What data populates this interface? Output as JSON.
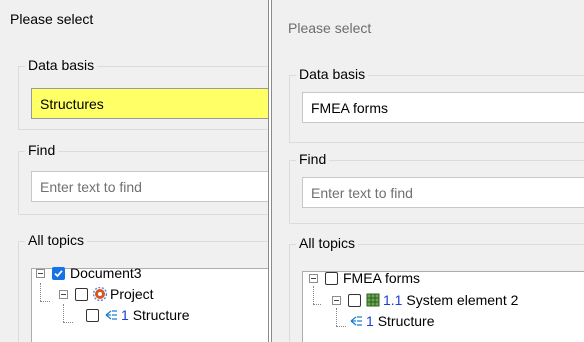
{
  "left": {
    "title": "Please select",
    "data_basis": {
      "label": "Data basis",
      "value": "Structures",
      "highlight_color": "#ffff66"
    },
    "find": {
      "label": "Find",
      "placeholder": "Enter text to find"
    },
    "topics": {
      "label": "All topics",
      "nodes": [
        {
          "label": "Document3",
          "checked": true
        },
        {
          "label": "Project",
          "checked": false,
          "icon": "gear-icon"
        },
        {
          "number": "1",
          "label": "Structure",
          "checked": false,
          "icon": "structure-tree-icon"
        }
      ]
    }
  },
  "right": {
    "title": "Please select",
    "data_basis": {
      "label": "Data basis",
      "value": "FMEA forms"
    },
    "find": {
      "label": "Find",
      "placeholder": "Enter text to find"
    },
    "topics": {
      "label": "All topics",
      "nodes": [
        {
          "label": "FMEA forms",
          "checked": false
        },
        {
          "number": "1.1",
          "label": "System element 2",
          "checked": false,
          "icon": "system-element-icon"
        },
        {
          "number": "1",
          "label": "Structure",
          "icon": "structure-tree-icon"
        }
      ]
    }
  },
  "colors": {
    "checkbox_checked": "#1473e6",
    "number_text": "#1a3fd1",
    "panel_bg": "#f0f0f0"
  }
}
